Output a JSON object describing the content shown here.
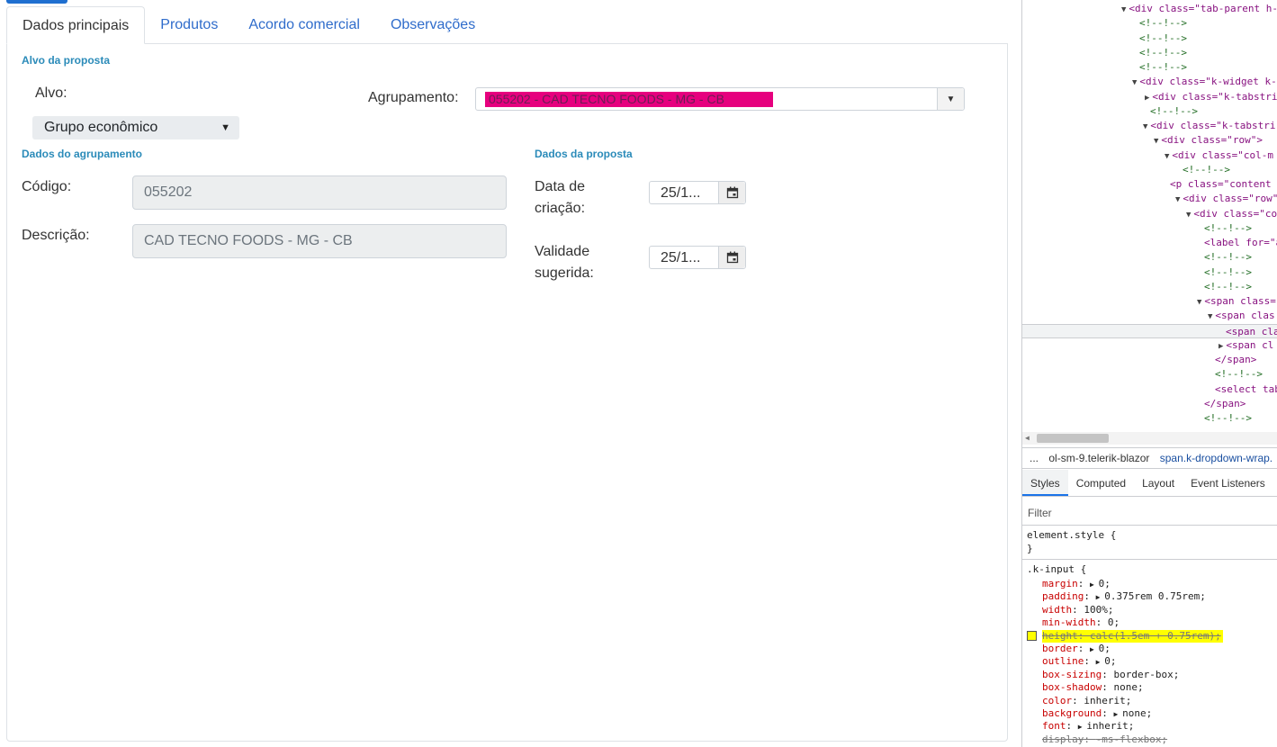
{
  "tabs": [
    {
      "label": "Dados principais",
      "active": true
    },
    {
      "label": "Produtos",
      "active": false
    },
    {
      "label": "Acordo comercial",
      "active": false
    },
    {
      "label": "Observações",
      "active": false
    }
  ],
  "target": {
    "section_title": "Alvo da proposta",
    "alvo_label": "Alvo:",
    "alvo_value": "Grupo econômico",
    "agrupamento_label": "Agrupamento:",
    "agrupamento_value": "055202 - CAD TECNO FOODS - MG - CB"
  },
  "group": {
    "section_title": "Dados do agrupamento",
    "codigo_label": "Código:",
    "codigo_value": "055202",
    "descricao_label": "Descrição:",
    "descricao_value": "CAD TECNO FOODS - MG - CB"
  },
  "proposal": {
    "section_title": "Dados da proposta",
    "data_criacao_label_1": "Data de",
    "data_criacao_label_2": "criação:",
    "data_criacao_value": "25/1...",
    "validade_label_1": "Validade",
    "validade_label_2": "sugerida:",
    "validade_value": "25/1..."
  },
  "devtools": {
    "dom": [
      {
        "text": "<div class=\"tab-parent h-",
        "kind": "tag",
        "arrow": "▼"
      },
      {
        "text": "<!--!-->",
        "kind": "cmt",
        "arrow": ""
      },
      {
        "text": "<!--!-->",
        "kind": "cmt",
        "arrow": ""
      },
      {
        "text": "<!--!-->",
        "kind": "cmt",
        "arrow": ""
      },
      {
        "text": "<!--!-->",
        "kind": "cmt",
        "arrow": ""
      },
      {
        "text": "<div class=\"k-widget k-",
        "kind": "tag",
        "arrow": "▼"
      },
      {
        "text": "<div class=\"k-tabstri",
        "kind": "tag",
        "arrow": "▶"
      },
      {
        "text": "<!--!-->",
        "kind": "cmt",
        "arrow": ""
      },
      {
        "text": "<div class=\"k-tabstri",
        "kind": "tag",
        "arrow": "▼"
      },
      {
        "text": "<div class=\"row\">",
        "kind": "tag",
        "arrow": "▼"
      },
      {
        "text": "<div class=\"col-m",
        "kind": "tag",
        "arrow": "▼"
      },
      {
        "text": "<!--!-->",
        "kind": "cmt",
        "arrow": ""
      },
      {
        "text": "<p class=\"content",
        "kind": "tag",
        "arrow": ""
      },
      {
        "text": "<div class=\"row\"",
        "kind": "tag",
        "arrow": "▼"
      },
      {
        "text": "<div class=\"co",
        "kind": "tag",
        "arrow": "▼"
      },
      {
        "text": "<!--!-->",
        "kind": "cmt",
        "arrow": ""
      },
      {
        "text": "<label for=\"a",
        "kind": "tag",
        "arrow": ""
      },
      {
        "text": "<!--!-->",
        "kind": "cmt",
        "arrow": ""
      },
      {
        "text": "<!--!-->",
        "kind": "cmt",
        "arrow": ""
      },
      {
        "text": "<!--!-->",
        "kind": "cmt",
        "arrow": ""
      },
      {
        "text": "<span class=",
        "kind": "tag",
        "arrow": "▼"
      },
      {
        "text": "<span clas",
        "kind": "tag",
        "arrow": "▼"
      },
      {
        "text": "<span cla",
        "kind": "tag",
        "arrow": ""
      },
      {
        "text": "<span cl",
        "kind": "tag",
        "arrow": "▶"
      },
      {
        "text": "</span>",
        "kind": "tag",
        "arrow": ""
      },
      {
        "text": "<!--!-->",
        "kind": "cmt",
        "arrow": ""
      },
      {
        "text": "<select tab",
        "kind": "tag",
        "arrow": ""
      },
      {
        "text": "</span>",
        "kind": "tag",
        "arrow": ""
      },
      {
        "text": "<!--!-->",
        "kind": "cmt",
        "arrow": ""
      }
    ],
    "breadcrumbs": [
      "...",
      "ol-sm-9.telerik-blazor",
      "span.k-dropdown-wrap."
    ],
    "panel_tabs": [
      "Styles",
      "Computed",
      "Layout",
      "Event Listeners"
    ],
    "filter_placeholder": "Filter",
    "element_style": "element.style {",
    "close_brace": "}",
    "rule_selector": ".k-input {",
    "props": [
      {
        "name": "margin",
        "value": "0;",
        "tri": true,
        "struck": false
      },
      {
        "name": "padding",
        "value": "0.375rem 0.75rem;",
        "tri": true,
        "struck": false
      },
      {
        "name": "width",
        "value": "100%;",
        "tri": false,
        "struck": false
      },
      {
        "name": "min-width",
        "value": "0;",
        "tri": false,
        "struck": false
      },
      {
        "name": "height",
        "value": "calc(1.5em + 0.75rem);",
        "tri": false,
        "struck": true
      },
      {
        "name": "border",
        "value": "0;",
        "tri": true,
        "struck": false
      },
      {
        "name": "outline",
        "value": "0;",
        "tri": true,
        "struck": false
      },
      {
        "name": "box-sizing",
        "value": "border-box;",
        "tri": false,
        "struck": false
      },
      {
        "name": "box-shadow",
        "value": "none;",
        "tri": false,
        "struck": false
      },
      {
        "name": "color",
        "value": "inherit;",
        "tri": false,
        "struck": false
      },
      {
        "name": "background",
        "value": "none;",
        "tri": true,
        "struck": false
      },
      {
        "name": "font",
        "value": "inherit;",
        "tri": true,
        "struck": false
      },
      {
        "name": "display",
        "value": "-ms-flexbox;",
        "tri": false,
        "struck": true
      }
    ]
  },
  "colors": {
    "accent": "#2f6ccb",
    "section_title": "#2b8bb9",
    "redaction": "#e6007e",
    "highlight": "#ffff00"
  }
}
